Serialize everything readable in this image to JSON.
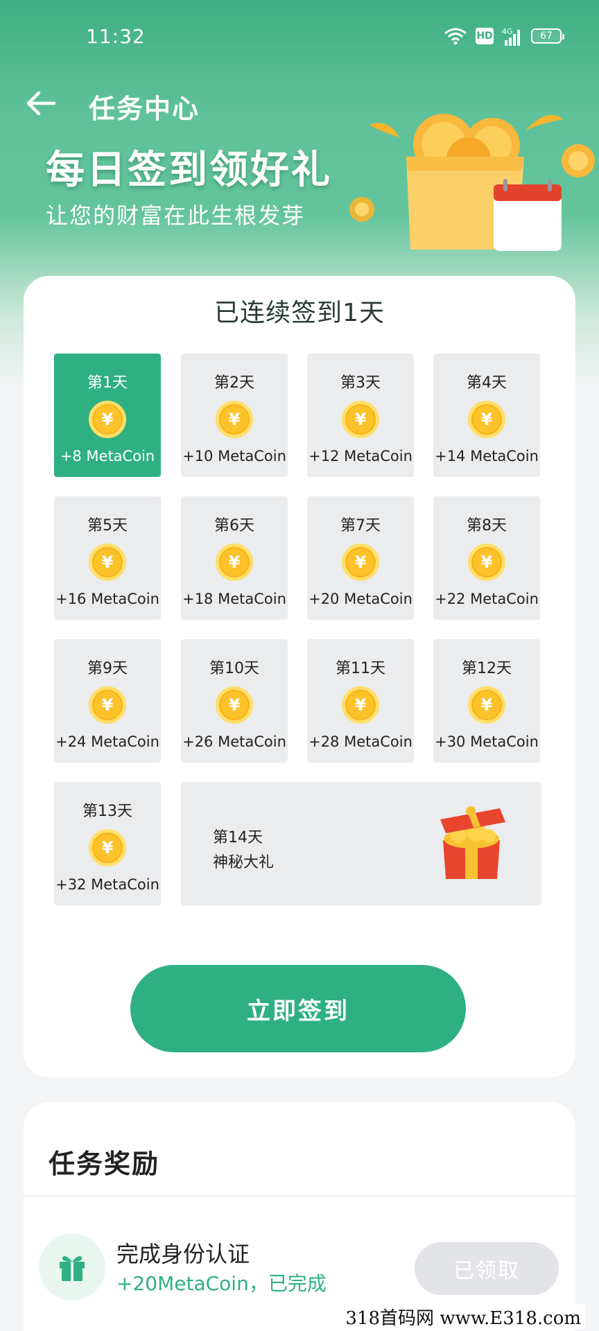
{
  "status_bar": {
    "time": "11:32",
    "hd": "HD",
    "network": "4G",
    "battery": "67"
  },
  "header": {
    "title": "任务中心"
  },
  "banner": {
    "title": "每日签到领好礼",
    "subtitle": "让您的财富在此生根发芽"
  },
  "signin": {
    "streak_text": "已连续签到1天",
    "days": [
      {
        "label": "第1天",
        "reward": "+8 MetaCoin",
        "active": true
      },
      {
        "label": "第2天",
        "reward": "+10 MetaCoin"
      },
      {
        "label": "第3天",
        "reward": "+12 MetaCoin"
      },
      {
        "label": "第4天",
        "reward": "+14 MetaCoin"
      },
      {
        "label": "第5天",
        "reward": "+16 MetaCoin"
      },
      {
        "label": "第6天",
        "reward": "+18 MetaCoin"
      },
      {
        "label": "第7天",
        "reward": "+20 MetaCoin"
      },
      {
        "label": "第8天",
        "reward": "+22 MetaCoin"
      },
      {
        "label": "第9天",
        "reward": "+24 MetaCoin"
      },
      {
        "label": "第10天",
        "reward": "+26 MetaCoin"
      },
      {
        "label": "第11天",
        "reward": "+28 MetaCoin"
      },
      {
        "label": "第12天",
        "reward": "+30 MetaCoin"
      },
      {
        "label": "第13天",
        "reward": "+32 MetaCoin"
      }
    ],
    "final_day": {
      "label": "第14天",
      "reward": "神秘大礼"
    },
    "coin_symbol": "¥",
    "button_label": "立即签到"
  },
  "tasks": {
    "title": "任务奖励",
    "items": [
      {
        "name": "完成身份认证",
        "desc": "+20MetaCoin，已完成",
        "button": "已领取"
      }
    ]
  },
  "watermark": "318首码网 www.E318.com",
  "colors": {
    "brand": "#2fb083",
    "coin": "#fcc22a",
    "tile": "#ebecee"
  },
  "icons": [
    "back-arrow-icon",
    "wifi-icon",
    "signal-icon",
    "battery-icon",
    "coin-icon",
    "gift-box-icon",
    "gift-icon"
  ]
}
